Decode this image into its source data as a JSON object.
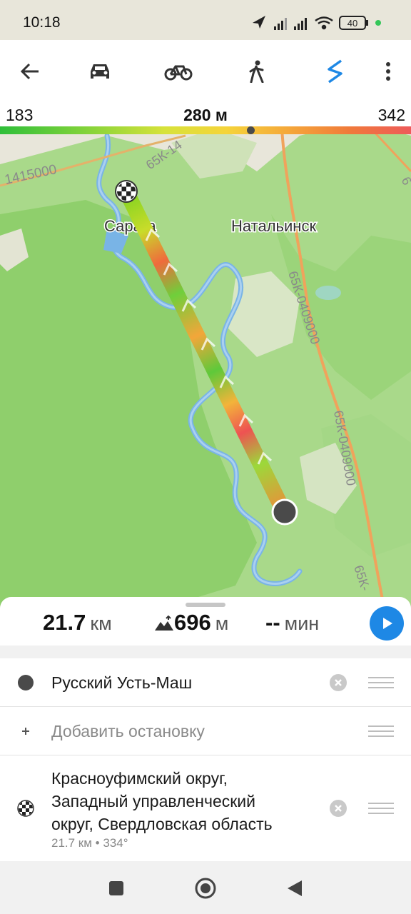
{
  "status": {
    "time": "10:18",
    "battery": "40"
  },
  "toolbar": {
    "modes": [
      "back",
      "car",
      "bicycle",
      "pedestrian",
      "ruler"
    ],
    "active_mode": "ruler",
    "active_color": "#1e88e5"
  },
  "elevation": {
    "min": "183",
    "current": "280 м",
    "max": "342",
    "marker_fraction": 0.61
  },
  "map": {
    "labels": [
      {
        "text": "Сарага",
        "kind": "town"
      },
      {
        "text": "Натальинск",
        "kind": "town"
      },
      {
        "text": "65К-14",
        "kind": "road"
      },
      {
        "text": "1415000",
        "kind": "road"
      },
      {
        "text": "65К-0409000",
        "kind": "road"
      },
      {
        "text": "65К-0409000",
        "kind": "road"
      },
      {
        "text": "65К-",
        "kind": "road"
      },
      {
        "text": "6",
        "kind": "road"
      }
    ]
  },
  "summary": {
    "distance_value": "21.7",
    "distance_unit": "км",
    "ascent_value": "696",
    "ascent_unit": "м",
    "time_value": "--",
    "time_unit": "мин"
  },
  "waypoints": {
    "start": {
      "label": "Русский Усть-Маш"
    },
    "add_stop": {
      "placeholder": "Добавить остановку"
    },
    "finish": {
      "line1": "Красноуфимский округ,",
      "line2": "Западный управленческий",
      "line3": "округ, Свердловская область",
      "meta": "21.7 км • 334°"
    }
  }
}
